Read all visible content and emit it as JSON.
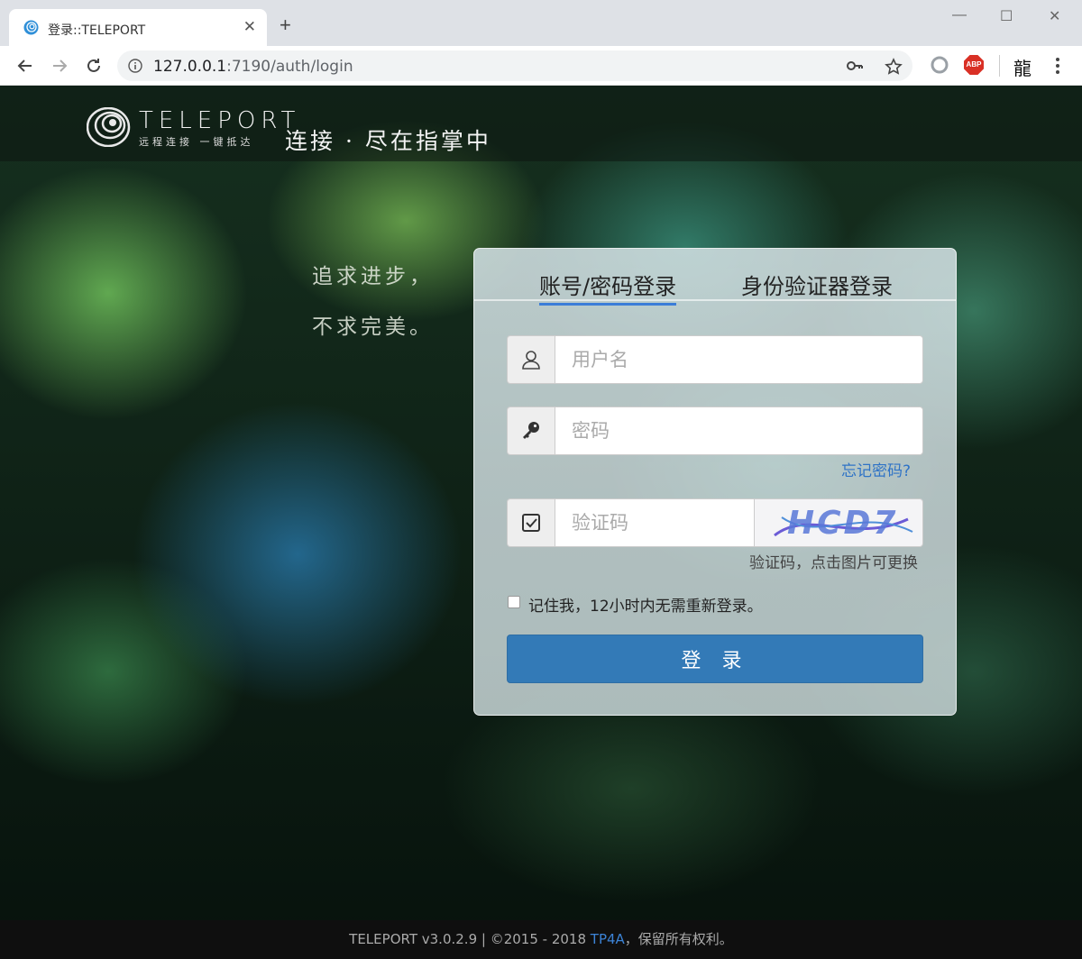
{
  "browser": {
    "tab_title": "登录::TELEPORT",
    "tab_close": "✕",
    "new_tab": "+",
    "url_host": "127.0.0.1",
    "url_path": ":7190/auth/login",
    "window_controls": {
      "minimize": "—",
      "maximize": "☐",
      "close": "✕"
    },
    "ext_abp": "ABP",
    "ext_profile": "龍"
  },
  "header": {
    "brand": "TELEPORT",
    "brand_sub": "远程连接 一键抵达",
    "slogan": "连接 · 尽在指掌中"
  },
  "motto": {
    "line1": "追求进步，",
    "line2": "不求完美。"
  },
  "login": {
    "tabs": [
      {
        "label": "账号/密码登录",
        "active": true
      },
      {
        "label": "身份验证器登录",
        "active": false
      }
    ],
    "username_placeholder": "用户名",
    "password_placeholder": "密码",
    "forgot_password": "忘记密码?",
    "captcha_placeholder": "验证码",
    "captcha_text": "HCD7",
    "captcha_hint": "验证码，点击图片可更换",
    "remember_label": "记住我，12小时内无需重新登录。",
    "submit_label": "登 录"
  },
  "footer": {
    "text_before": "TELEPORT v3.0.2.9 | ©2015 - 2018 ",
    "link": "TP4A",
    "text_after": "，保留所有权利。"
  },
  "colors": {
    "accent": "#337ab7",
    "link": "#2f73c6",
    "tab_underline": "#3b7dd8"
  }
}
